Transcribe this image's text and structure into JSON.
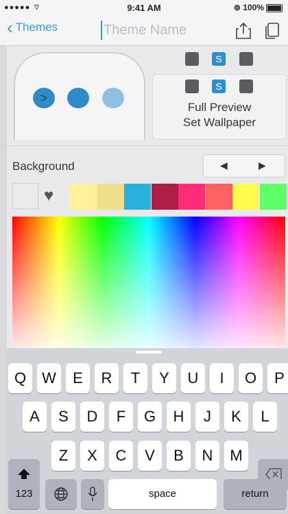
{
  "status_bar": {
    "time": "9:41 AM",
    "battery": "100%"
  },
  "nav": {
    "back_label": "Themes",
    "title_placeholder": "Theme Name"
  },
  "preview": {
    "bubble_icon": ">",
    "button_line1": "Full Preview",
    "button_line2": "Set Wallpaper",
    "selected_symbol": "S"
  },
  "background": {
    "label": "Background",
    "prev_icon": "◀",
    "next_icon": "▶",
    "favorite_icon": "heart-icon",
    "swatches": [
      "#fff19b",
      "#efdf8b",
      "#2ab0dc",
      "#ae1e46",
      "#fd2c77",
      "#ff6265",
      "#fffc4d",
      "#5eff66"
    ]
  },
  "keyboard": {
    "row1": [
      "Q",
      "W",
      "E",
      "R",
      "T",
      "Y",
      "U",
      "I",
      "O",
      "P"
    ],
    "row2": [
      "A",
      "S",
      "D",
      "F",
      "G",
      "H",
      "J",
      "K",
      "L"
    ],
    "row3": [
      "Z",
      "X",
      "C",
      "V",
      "B",
      "N",
      "M"
    ],
    "numbers_label": "123",
    "space_label": "space",
    "return_label": "return",
    "shift_icon": "shift-icon",
    "delete_icon": "delete-icon",
    "globe_icon": "globe-icon",
    "mic_icon": "mic-icon"
  }
}
